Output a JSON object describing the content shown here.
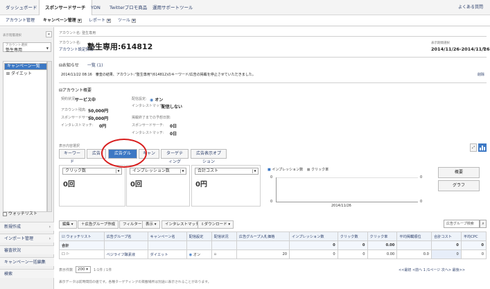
{
  "topnav": {
    "tabs": [
      "ダッシュボード",
      "スポンサードサーチ",
      "YDN",
      "Twitterプロモ商品",
      "運用サポートツール"
    ],
    "faq": "よくある質問"
  },
  "subnav": {
    "items": [
      "アカウント管理",
      "キャンペーン管理",
      "レポート",
      "ツール"
    ]
  },
  "sidebar": {
    "label_select": "表示階層選択",
    "label_account": "アカウント選択",
    "account": "塾生専用",
    "tree": [
      "キャンペーン一覧",
      "ダイエット"
    ],
    "watchlist": "ウォッチリスト",
    "links": [
      "新規作成",
      "インポート管理",
      "審査状況",
      "キャンペーン一括編集",
      "検索"
    ]
  },
  "main": {
    "breadcrumb": "アカウント名: 塾生専用",
    "account_label": "アカウント名:",
    "account_settings": "アカウント設定情報",
    "account_title": "塾生専用:614812",
    "date_label": "表示期間選択",
    "date_range": "2014/11/26-2014/11/26",
    "notice_header": "お知らせ",
    "notice_link": "一覧 (1)",
    "notice_text": "2014/11/22 08:16　審査の結果、アカウント:\"塾生専用\"(614812)のキーワード/広告の掲載を停止させていただきました。",
    "notice_delete": "削除",
    "overview_header": "アカウント概要",
    "overview": {
      "status_label": "契約状況:",
      "status_value": "サービス中",
      "budget_label": "アカウント残高:",
      "budget_value": "50,000円",
      "sponsor_label": "スポンサードサーチ:",
      "sponsor_value": "50,000円",
      "interest_label": "インタレストマッチ:",
      "interest_value": "0円",
      "delivery_label": "配信設定:",
      "delivery_value": "オン",
      "im_label": "インタレストマッチ:",
      "im_value": "配信しない",
      "remaining_label": "掲載終了までの予想日数:",
      "rem_sponsor_label": "スポンサードサーチ:",
      "rem_sponsor_value": "0日",
      "rem_interest_label": "インタレストマッチ:",
      "rem_interest_value": "0日"
    },
    "view_label": "表示内容選択",
    "tabs": [
      "キーワード",
      "広告",
      "広告グループ",
      "キャンペーン",
      "ターゲティング",
      "広告表示オプション"
    ],
    "metrics": [
      {
        "label": "クリック数",
        "value": "0回"
      },
      {
        "label": "インプレッション数",
        "value": "0回"
      },
      {
        "label": "合計コスト",
        "value": "0円"
      }
    ],
    "chart": {
      "legend": [
        "インプレッション数",
        "クリック率"
      ],
      "x_label": "2014/11/26",
      "y_left": [
        "0"
      ],
      "y_right": [
        "0"
      ]
    },
    "chart_buttons": [
      "概要",
      "グラフ"
    ],
    "toolbar": [
      "編集",
      "広告グループ作成",
      "フィルター",
      "表示",
      "インタレストマッチ",
      "ダウンロード"
    ],
    "search_placeholder": "広告グループ検索",
    "table": {
      "headers": [
        "ウォッチリスト",
        "広告グループ名",
        "キャンペーン名",
        "配信設定",
        "配信状況",
        "広告グループ入札価格",
        "インプレッション数",
        "クリック数",
        "クリック率",
        "平均掲載順位",
        "合計コスト",
        "平均CPC"
      ],
      "total": [
        "合計",
        "",
        "",
        "",
        "",
        "",
        "0",
        "0",
        "0.00",
        "",
        "0",
        "0"
      ],
      "rows": [
        [
          "",
          "ベジライフ酵素液",
          "ダイエット",
          "オン",
          "",
          "20",
          "0",
          "0",
          "0.00",
          "0.0",
          "0",
          "0"
        ]
      ]
    },
    "pager_label": "表示件数",
    "pager_size": "200",
    "pager_range": "1-1件 / 1件",
    "pager_nav": "<<最初 <前へ 1 /1ページ 次へ> 最後>>",
    "footnote": "表示データは前時間前の値です。各種ターゲティングの掲載場所は別途に表示されることがあります。"
  }
}
